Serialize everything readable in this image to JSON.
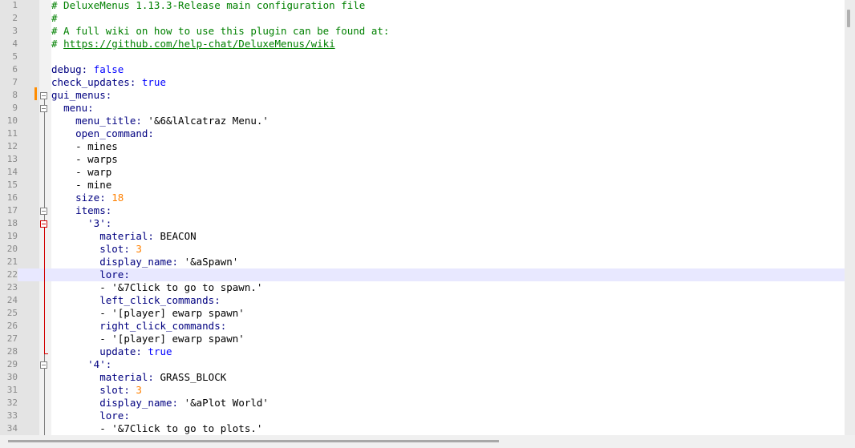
{
  "editor": {
    "language": "yaml",
    "current_line": 22,
    "colors": {
      "comment": "#008000",
      "key": "#000080",
      "number": "#ff8000",
      "boolean": "#0000ff",
      "current_line_bg": "#e8e8ff",
      "fold_active": "#d00000"
    },
    "lines": [
      {
        "n": "1",
        "indent": "",
        "parts": [
          {
            "t": "# DeluxeMenus 1.13.3-Release main configuration file",
            "c": "cmt"
          }
        ]
      },
      {
        "n": "2",
        "indent": "",
        "parts": [
          {
            "t": "#",
            "c": "cmt"
          }
        ]
      },
      {
        "n": "3",
        "indent": "",
        "parts": [
          {
            "t": "# A full wiki on how to use this plugin can be found at:",
            "c": "cmt"
          }
        ]
      },
      {
        "n": "4",
        "indent": "",
        "parts": [
          {
            "t": "# ",
            "c": "cmt"
          },
          {
            "t": "https://github.com/help-chat/DeluxeMenus/wiki",
            "c": "link"
          }
        ]
      },
      {
        "n": "5",
        "indent": "",
        "parts": []
      },
      {
        "n": "6",
        "indent": "",
        "parts": [
          {
            "t": "debug:",
            "c": "key"
          },
          {
            "t": " false",
            "c": "bool"
          }
        ]
      },
      {
        "n": "7",
        "indent": "",
        "parts": [
          {
            "t": "check_updates:",
            "c": "key"
          },
          {
            "t": " true",
            "c": "bool"
          }
        ]
      },
      {
        "n": "8",
        "indent": "",
        "parts": [
          {
            "t": "gui_menus:",
            "c": "key"
          }
        ]
      },
      {
        "n": "9",
        "indent": "  ",
        "parts": [
          {
            "t": "menu:",
            "c": "key"
          }
        ]
      },
      {
        "n": "10",
        "indent": "    ",
        "parts": [
          {
            "t": "menu_title:",
            "c": "key"
          },
          {
            "t": " '&6&lAlcatraz Menu.'",
            "c": "val"
          }
        ]
      },
      {
        "n": "11",
        "indent": "    ",
        "parts": [
          {
            "t": "open_command:",
            "c": "key"
          }
        ]
      },
      {
        "n": "12",
        "indent": "    ",
        "parts": [
          {
            "t": "- mines",
            "c": "val"
          }
        ]
      },
      {
        "n": "13",
        "indent": "    ",
        "parts": [
          {
            "t": "- warps",
            "c": "val"
          }
        ]
      },
      {
        "n": "14",
        "indent": "    ",
        "parts": [
          {
            "t": "- warp",
            "c": "val"
          }
        ]
      },
      {
        "n": "15",
        "indent": "    ",
        "parts": [
          {
            "t": "- mine",
            "c": "val"
          }
        ]
      },
      {
        "n": "16",
        "indent": "    ",
        "parts": [
          {
            "t": "size:",
            "c": "key"
          },
          {
            "t": " 18",
            "c": "num"
          }
        ]
      },
      {
        "n": "17",
        "indent": "    ",
        "parts": [
          {
            "t": "items:",
            "c": "key"
          }
        ]
      },
      {
        "n": "18",
        "indent": "      ",
        "parts": [
          {
            "t": "'3':",
            "c": "key"
          }
        ]
      },
      {
        "n": "19",
        "indent": "        ",
        "parts": [
          {
            "t": "material:",
            "c": "key"
          },
          {
            "t": " BEACON",
            "c": "val"
          }
        ]
      },
      {
        "n": "20",
        "indent": "        ",
        "parts": [
          {
            "t": "slot:",
            "c": "key"
          },
          {
            "t": " 3",
            "c": "num"
          }
        ]
      },
      {
        "n": "21",
        "indent": "        ",
        "parts": [
          {
            "t": "display_name:",
            "c": "key"
          },
          {
            "t": " '&aSpawn'",
            "c": "val"
          }
        ]
      },
      {
        "n": "22",
        "indent": "        ",
        "parts": [
          {
            "t": "lore:",
            "c": "key"
          }
        ]
      },
      {
        "n": "23",
        "indent": "        ",
        "parts": [
          {
            "t": "- '&7Click to go to spawn.'",
            "c": "val"
          }
        ]
      },
      {
        "n": "24",
        "indent": "        ",
        "parts": [
          {
            "t": "left_click_commands:",
            "c": "key"
          }
        ]
      },
      {
        "n": "25",
        "indent": "        ",
        "parts": [
          {
            "t": "- '[player] ewarp spawn'",
            "c": "val"
          }
        ]
      },
      {
        "n": "26",
        "indent": "        ",
        "parts": [
          {
            "t": "right_click_commands:",
            "c": "key"
          }
        ]
      },
      {
        "n": "27",
        "indent": "        ",
        "parts": [
          {
            "t": "- '[player] ewarp spawn'",
            "c": "val"
          }
        ]
      },
      {
        "n": "28",
        "indent": "        ",
        "parts": [
          {
            "t": "update:",
            "c": "key"
          },
          {
            "t": " true",
            "c": "bool"
          }
        ]
      },
      {
        "n": "29",
        "indent": "      ",
        "parts": [
          {
            "t": "'4':",
            "c": "key"
          }
        ]
      },
      {
        "n": "30",
        "indent": "        ",
        "parts": [
          {
            "t": "material:",
            "c": "key"
          },
          {
            "t": " GRASS_BLOCK",
            "c": "val"
          }
        ]
      },
      {
        "n": "31",
        "indent": "        ",
        "parts": [
          {
            "t": "slot:",
            "c": "key"
          },
          {
            "t": " 3",
            "c": "num"
          }
        ]
      },
      {
        "n": "32",
        "indent": "        ",
        "parts": [
          {
            "t": "display_name:",
            "c": "key"
          },
          {
            "t": " '&aPlot World'",
            "c": "val"
          }
        ]
      },
      {
        "n": "33",
        "indent": "        ",
        "parts": [
          {
            "t": "lore:",
            "c": "key"
          }
        ]
      },
      {
        "n": "34",
        "indent": "        ",
        "parts": [
          {
            "t": "- '&7Click to go to plots.'",
            "c": "val"
          }
        ]
      }
    ],
    "folds": [
      {
        "line": 8,
        "state": "expanded",
        "active": false
      },
      {
        "line": 9,
        "state": "expanded",
        "active": false
      },
      {
        "line": 17,
        "state": "expanded",
        "active": false
      },
      {
        "line": 18,
        "state": "expanded",
        "active": true
      },
      {
        "line": 29,
        "state": "expanded",
        "active": false
      }
    ],
    "changed_lines": [
      8
    ]
  }
}
